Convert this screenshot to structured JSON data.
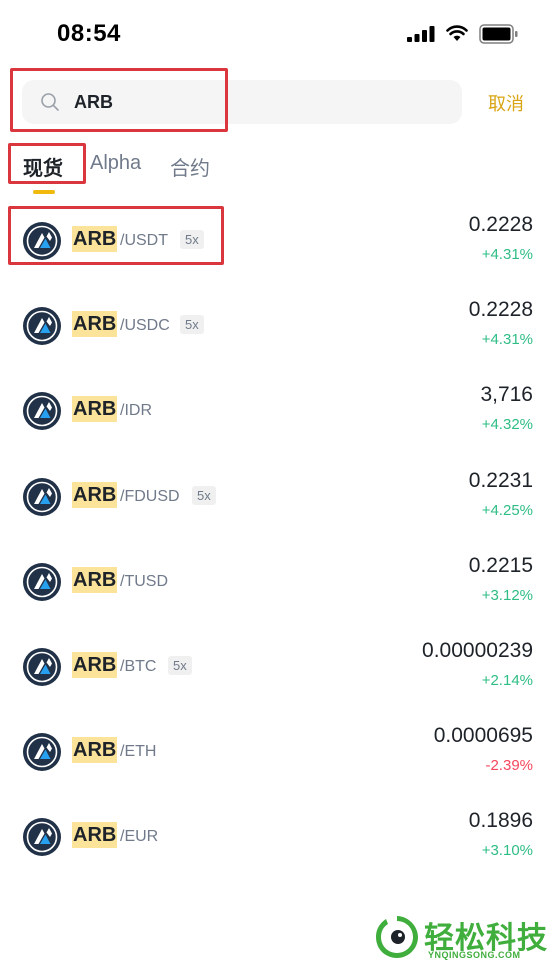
{
  "status_bar": {
    "time": "08:54"
  },
  "search": {
    "value": "ARB",
    "cancel_label": "取消"
  },
  "tabs": [
    {
      "label": "现货",
      "active": true
    },
    {
      "label": "Alpha",
      "active": false
    },
    {
      "label": "合约",
      "active": false
    }
  ],
  "pairs": [
    {
      "base": "ARB",
      "quote": "/USDT",
      "leverage": "5x",
      "price": "0.2228",
      "change": "+4.31%",
      "direction": "up"
    },
    {
      "base": "ARB",
      "quote": "/USDC",
      "leverage": "5x",
      "price": "0.2228",
      "change": "+4.31%",
      "direction": "up"
    },
    {
      "base": "ARB",
      "quote": "/IDR",
      "leverage": "",
      "price": "3,716",
      "change": "+4.32%",
      "direction": "up"
    },
    {
      "base": "ARB",
      "quote": "/FDUSD",
      "leverage": "5x",
      "price": "0.2231",
      "change": "+4.25%",
      "direction": "up"
    },
    {
      "base": "ARB",
      "quote": "/TUSD",
      "leverage": "",
      "price": "0.2215",
      "change": "+3.12%",
      "direction": "up"
    },
    {
      "base": "ARB",
      "quote": "/BTC",
      "leverage": "5x",
      "price": "0.00000239",
      "change": "+2.14%",
      "direction": "up"
    },
    {
      "base": "ARB",
      "quote": "/ETH",
      "leverage": "",
      "price": "0.0000695",
      "change": "-2.39%",
      "direction": "down"
    },
    {
      "base": "ARB",
      "quote": "/EUR",
      "leverage": "",
      "price": "0.1896",
      "change": "+3.10%",
      "direction": "up"
    }
  ],
  "colors": {
    "accent": "#f0b90b",
    "up": "#2ebd85",
    "down": "#f6465d",
    "highlight_box": "#d9363e"
  },
  "watermark": {
    "text": "轻松科技",
    "sub": "YNQINGSONG.COM"
  }
}
